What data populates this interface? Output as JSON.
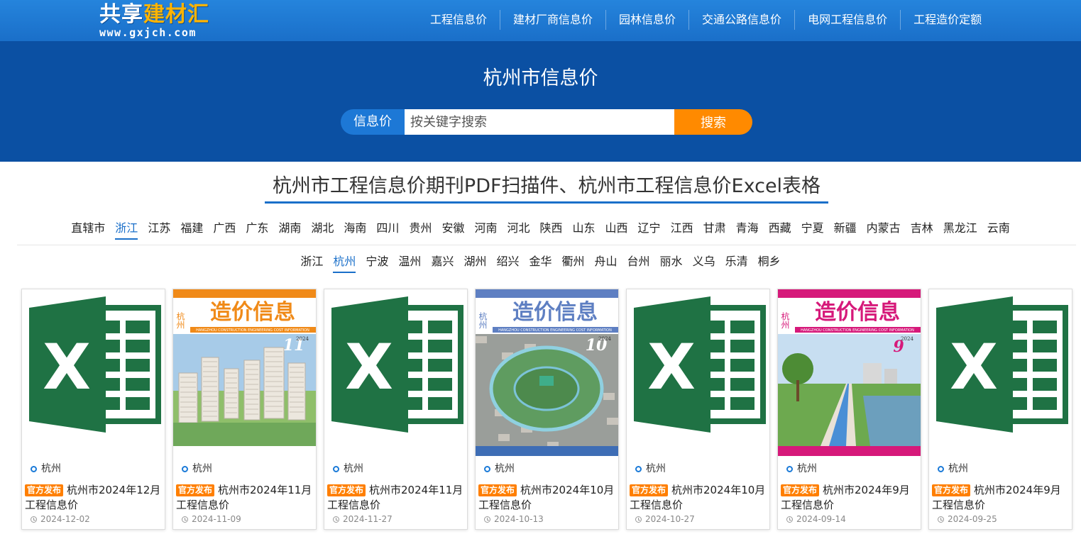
{
  "header": {
    "logo_text_a": "共享",
    "logo_text_b": "建材汇",
    "logo_url": "www.gxjch.com",
    "nav": [
      "工程信息价",
      "建材厂商信息价",
      "园林信息价",
      "交通公路信息价",
      "电网工程信息价",
      "工程造价定额"
    ]
  },
  "hero": {
    "title": "杭州市信息价",
    "search_label": "信息价",
    "search_placeholder": "按关键字搜索",
    "search_button": "搜索"
  },
  "section_title": "杭州市工程信息价期刊PDF扫描件、杭州市工程信息价Excel表格",
  "provinces": [
    "直辖市",
    "浙江",
    "江苏",
    "福建",
    "广西",
    "广东",
    "湖南",
    "湖北",
    "海南",
    "四川",
    "贵州",
    "安徽",
    "河南",
    "河北",
    "陕西",
    "山东",
    "山西",
    "辽宁",
    "江西",
    "甘肃",
    "青海",
    "西藏",
    "宁夏",
    "新疆",
    "内蒙古",
    "吉林",
    "黑龙江",
    "云南"
  ],
  "active_province": "浙江",
  "cities": [
    "浙江",
    "杭州",
    "宁波",
    "温州",
    "嘉兴",
    "湖州",
    "绍兴",
    "金华",
    "衢州",
    "舟山",
    "台州",
    "丽水",
    "义乌",
    "乐清",
    "桐乡"
  ],
  "active_city": "杭州",
  "cover": {
    "city_vertical": "杭州",
    "magazine_title": "造价信息",
    "english_title": "HANGZHOU CONSTRUCTION ENGINEERING COST INFORMATION",
    "year": "2024"
  },
  "cards": [
    {
      "type": "excel",
      "location": "杭州",
      "badge": "官方发布",
      "title": "杭州市2024年12月工程信息价",
      "date": "2024-12-02"
    },
    {
      "type": "cover",
      "location": "杭州",
      "badge": "官方发布",
      "title": "杭州市2024年11月工程信息价",
      "date": "2024-11-09",
      "issue": "11",
      "accent": "#f08a18",
      "scene": "towers"
    },
    {
      "type": "excel",
      "location": "杭州",
      "badge": "官方发布",
      "title": "杭州市2024年11月工程信息价",
      "date": "2024-11-27"
    },
    {
      "type": "cover",
      "location": "杭州",
      "badge": "官方发布",
      "title": "杭州市2024年10月工程信息价",
      "date": "2024-10-13",
      "issue": "10",
      "accent": "#5e7fc2",
      "scene": "park"
    },
    {
      "type": "excel",
      "location": "杭州",
      "badge": "官方发布",
      "title": "杭州市2024年10月工程信息价",
      "date": "2024-10-27"
    },
    {
      "type": "cover",
      "location": "杭州",
      "badge": "官方发布",
      "title": "杭州市2024年9月工程信息价",
      "date": "2024-09-14",
      "issue": "9",
      "accent": "#d6197a",
      "scene": "river"
    },
    {
      "type": "excel",
      "location": "杭州",
      "badge": "官方发布",
      "title": "杭州市2024年9月工程信息价",
      "date": "2024-09-25"
    }
  ],
  "colors": {
    "brand_blue": "#1a6fc9",
    "hero_blue": "#0b50a3",
    "orange": "#ff8a00",
    "excel_green": "#1f7244"
  }
}
